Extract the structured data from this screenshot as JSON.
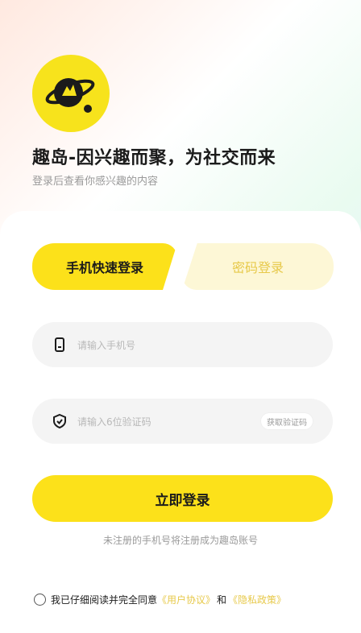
{
  "header": {
    "slogan": "趣岛-因兴趣而聚，为社交而来",
    "subtitle": "登录后查看你感兴趣的内容"
  },
  "tabs": [
    {
      "label": "手机快速登录",
      "active": true
    },
    {
      "label": "密码登录",
      "active": false
    }
  ],
  "phone": {
    "placeholder": "请输入手机号",
    "icon": "phone-icon"
  },
  "code": {
    "placeholder": "请输入6位验证码",
    "icon": "shield-icon",
    "button": "获取验证码"
  },
  "login_button": "立即登录",
  "hint": "未注册的手机号将注册成为趣岛账号",
  "agreement": {
    "prefix": "我已仔细阅读并完全同意",
    "user_agreement": "《用户协议》",
    "and": "和",
    "privacy_policy": "《隐私政策》"
  },
  "colors": {
    "accent": "#fce11a",
    "link": "#e7c94a"
  }
}
